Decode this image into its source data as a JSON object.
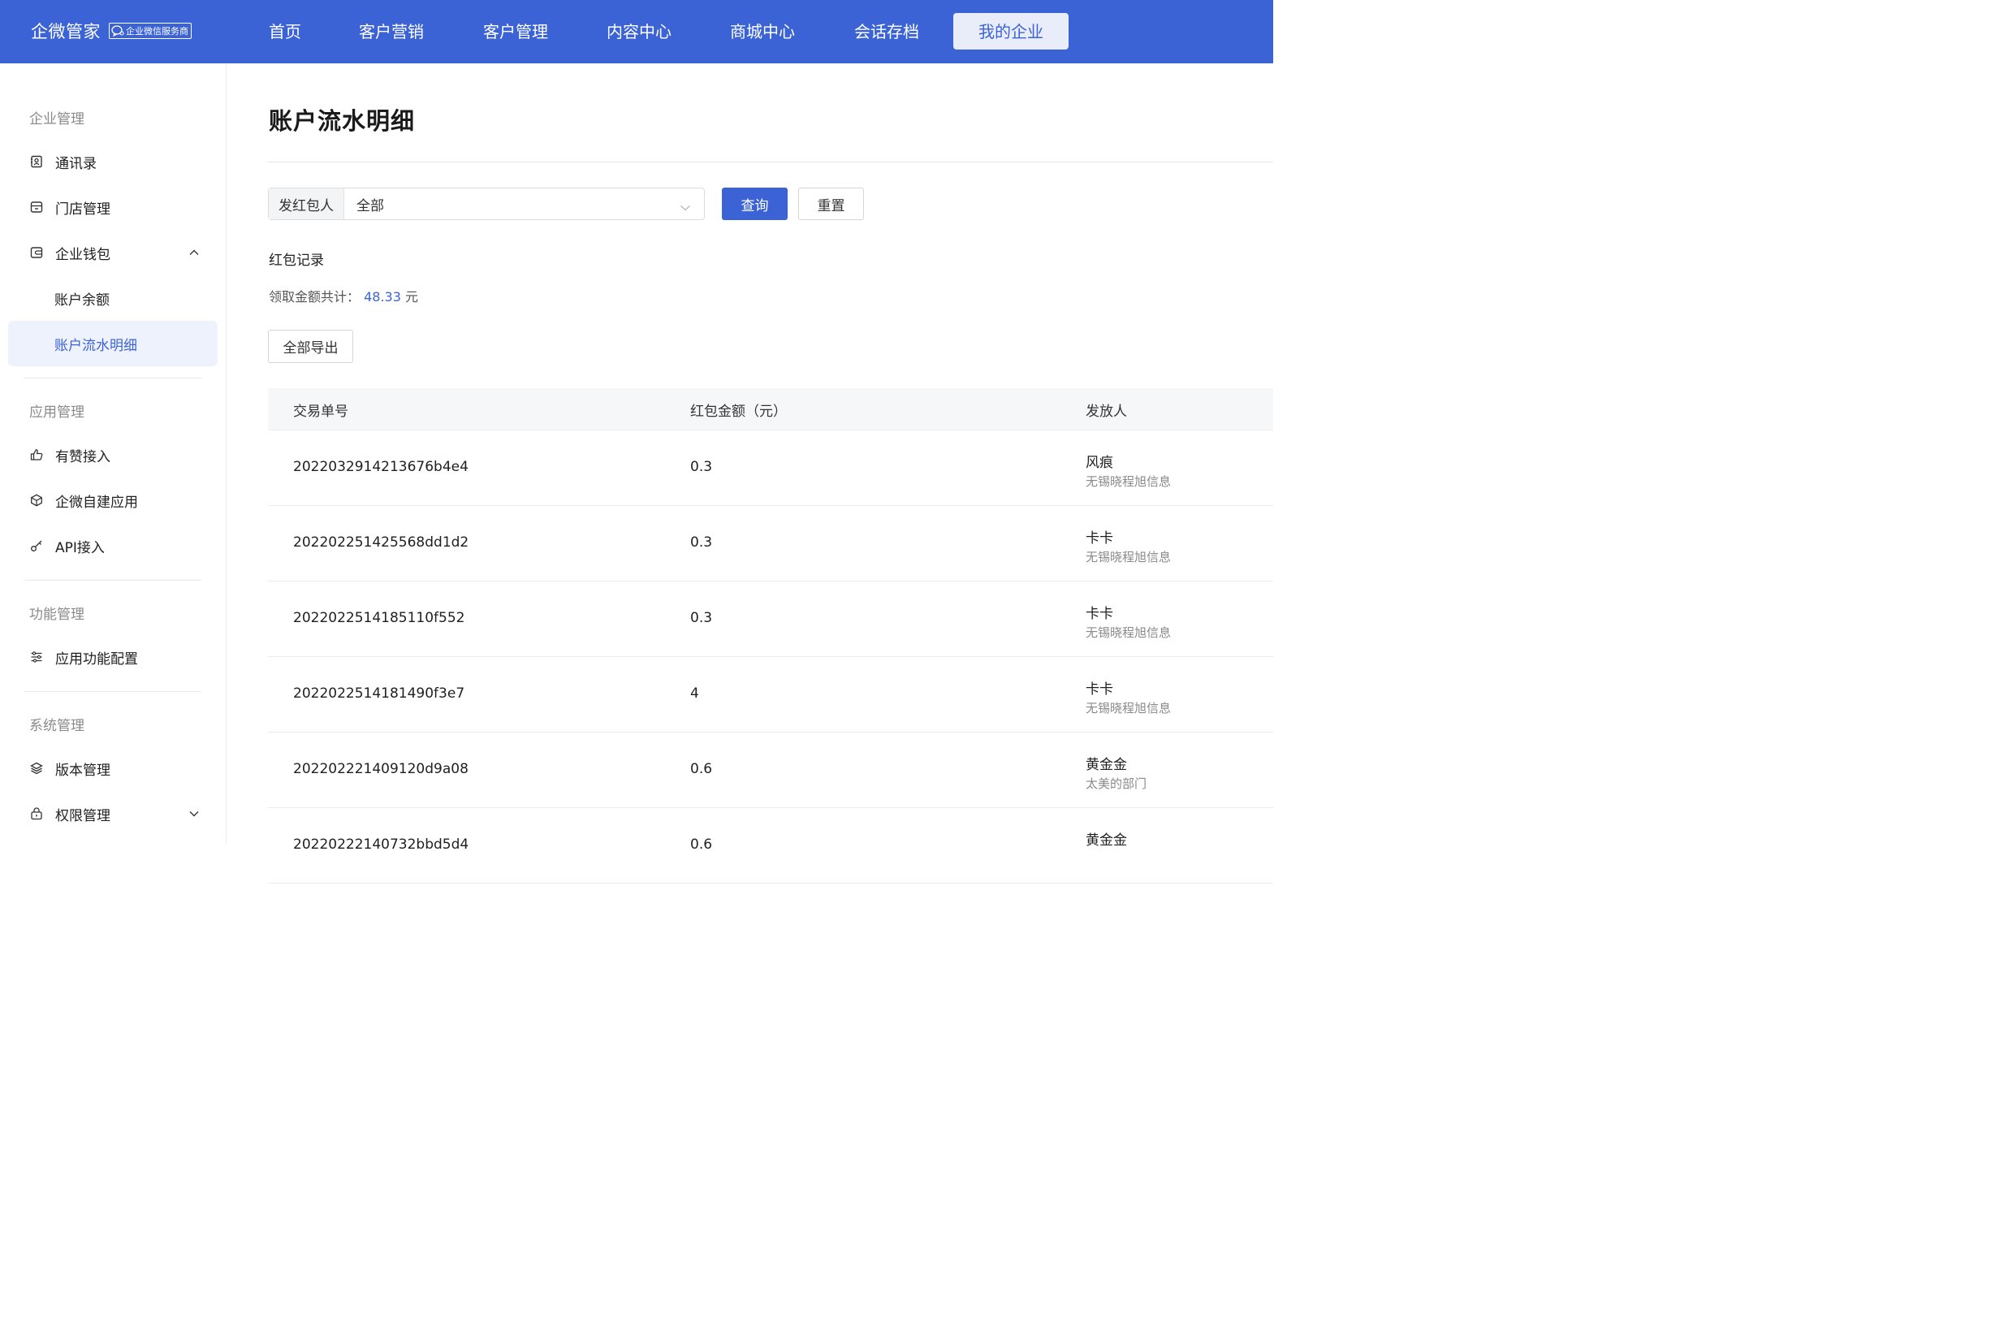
{
  "brand": {
    "name": "企微管家",
    "badge": "企业微信服务商"
  },
  "nav": [
    "首页",
    "客户营销",
    "客户管理",
    "内容中心",
    "商城中心",
    "会话存档",
    "我的企业"
  ],
  "nav_active": "我的企业",
  "sidebar": {
    "groups": [
      {
        "title": "企业管理",
        "items": [
          {
            "label": "通讯录",
            "icon": "contacts-icon"
          },
          {
            "label": "门店管理",
            "icon": "store-icon"
          },
          {
            "label": "企业钱包",
            "icon": "wallet-icon",
            "expanded": true,
            "children": [
              "账户余额",
              "账户流水明细"
            ]
          }
        ]
      },
      {
        "title": "应用管理",
        "items": [
          {
            "label": "有赞接入",
            "icon": "thumbs-up-icon"
          },
          {
            "label": "企微自建应用",
            "icon": "cube-icon"
          },
          {
            "label": "API接入",
            "icon": "key-icon"
          }
        ]
      },
      {
        "title": "功能管理",
        "items": [
          {
            "label": "应用功能配置",
            "icon": "sliders-icon"
          }
        ]
      },
      {
        "title": "系统管理",
        "items": [
          {
            "label": "版本管理",
            "icon": "layers-icon"
          },
          {
            "label": "权限管理",
            "icon": "lock-icon",
            "expanded": false
          }
        ]
      }
    ],
    "selected": "账户流水明细"
  },
  "main": {
    "title": "账户流水明细",
    "filter": {
      "label": "发红包人",
      "value": "全部"
    },
    "query_button": "查询",
    "reset_button": "重置",
    "section": "红包记录",
    "total_label": "领取金额共计：",
    "total_amount": "48.33",
    "total_unit": "元",
    "export_button": "全部导出",
    "table": {
      "columns": [
        "交易单号",
        "红包金额（元）",
        "发放人"
      ],
      "rows": [
        {
          "id": "202203291421367 6b4e4",
          "amount": "0.3",
          "sender": "风痕",
          "dept": "无锡晓程旭信息"
        },
        {
          "id": "202202251425568dd1d2",
          "amount": "0.3",
          "sender": "卡卡",
          "dept": "无锡晓程旭信息"
        },
        {
          "id": "202202251418511 0f552",
          "amount": "0.3",
          "sender": "卡卡",
          "dept": "无锡晓程旭信息"
        },
        {
          "id": "202202251418149 0f3e7",
          "amount": "4",
          "sender": "卡卡",
          "dept": "无锡晓程旭信息"
        },
        {
          "id": "202202221409120d9a08",
          "amount": "0.6",
          "sender": "黄金金",
          "dept": "太美的部门"
        },
        {
          "id": "20220222140732bbd5d4",
          "amount": "0.6",
          "sender": "黄金金",
          "dept": ""
        }
      ]
    }
  }
}
